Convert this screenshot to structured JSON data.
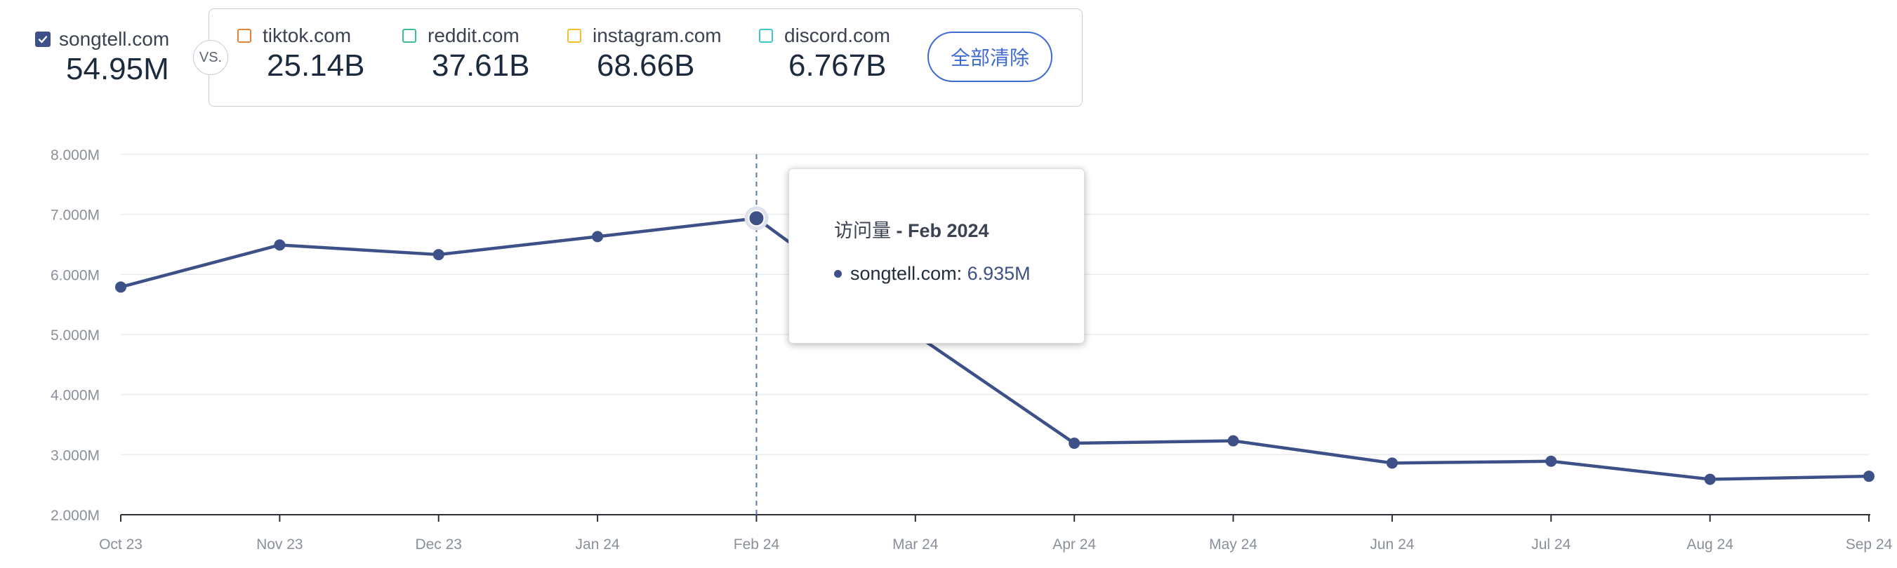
{
  "primary": {
    "name": "songtell.com",
    "value": "54.95M",
    "checked": true,
    "color": "#3d5087"
  },
  "vs_label": "VS.",
  "competitors": [
    {
      "name": "tiktok.com",
      "value": "25.14B",
      "color": "#e8833a"
    },
    {
      "name": "reddit.com",
      "value": "37.61B",
      "color": "#3cbf9a"
    },
    {
      "name": "instagram.com",
      "value": "68.66B",
      "color": "#f2c02c"
    },
    {
      "name": "discord.com",
      "value": "6.767B",
      "color": "#3fc6d1"
    }
  ],
  "clear_all_label": "全部清除",
  "tooltip": {
    "metric": "访问量",
    "separator": " - ",
    "period": "Feb 2024",
    "series_name": "songtell.com",
    "value": "6.935M"
  },
  "chart_data": {
    "type": "line",
    "x": [
      "Oct 23",
      "Nov 23",
      "Dec 23",
      "Jan 24",
      "Feb 24",
      "Mar 24",
      "Apr 24",
      "May 24",
      "Jun 24",
      "Jul 24",
      "Aug 24",
      "Sep 24"
    ],
    "series": [
      {
        "name": "songtell.com",
        "color": "#3d5087",
        "values": [
          5.79,
          6.49,
          6.33,
          6.63,
          6.935,
          5.0,
          3.19,
          3.23,
          2.86,
          2.89,
          2.59,
          2.64
        ]
      }
    ],
    "ylim": [
      2,
      8
    ],
    "yticks": [
      2,
      3,
      4,
      5,
      6,
      7,
      8
    ],
    "ytick_labels": [
      "2.000M",
      "3.000M",
      "4.000M",
      "5.000M",
      "6.000M",
      "7.000M",
      "8.000M"
    ],
    "highlight_index": 4,
    "grid": true,
    "title": "",
    "xlabel": "",
    "ylabel": ""
  }
}
